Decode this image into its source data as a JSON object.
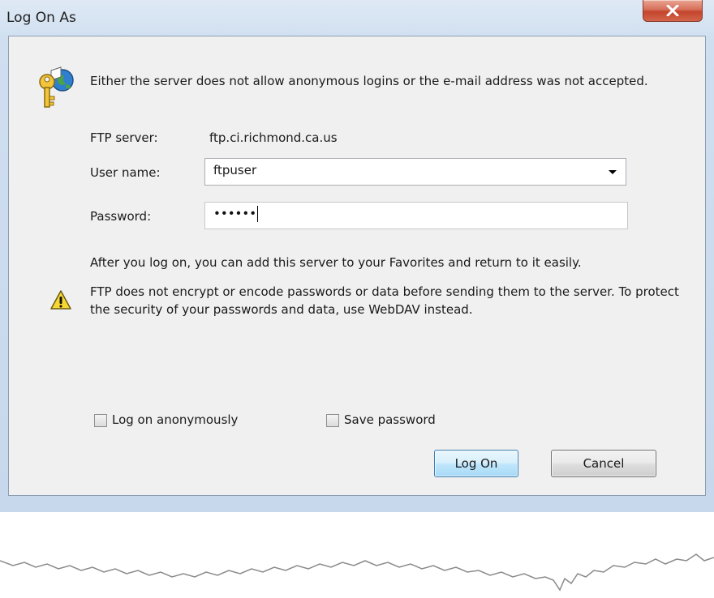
{
  "window": {
    "title": "Log On As"
  },
  "dialog": {
    "message": "Either the server does not allow anonymous logins or the e-mail address was not accepted.",
    "ftp_server_label": "FTP server:",
    "ftp_server_value": "ftp.ci.richmond.ca.us",
    "user_name_label": "User name:",
    "user_name_value": "ftpuser",
    "password_label": "Password:",
    "password_masked": "••••••",
    "after_logon_text": "After you log on, you can add this server to your Favorites and return to it easily.",
    "warning_text": "FTP does not encrypt or encode passwords or data before sending them to the server.  To protect the security of your passwords and data, use WebDAV instead.",
    "log_on_anonymously_label": "Log on anonymously",
    "log_on_anonymously_checked": false,
    "save_password_label": "Save password",
    "save_password_checked": false,
    "log_on_button": "Log On",
    "cancel_button": "Cancel"
  },
  "icons": {
    "key": "key-icon",
    "warning": "warning-icon",
    "close": "close-icon",
    "dropdown": "chevron-down-icon"
  },
  "colors": {
    "close_button": "#c4452c",
    "default_button_border": "#3c7fb1",
    "client_background": "#f0f0f0"
  }
}
